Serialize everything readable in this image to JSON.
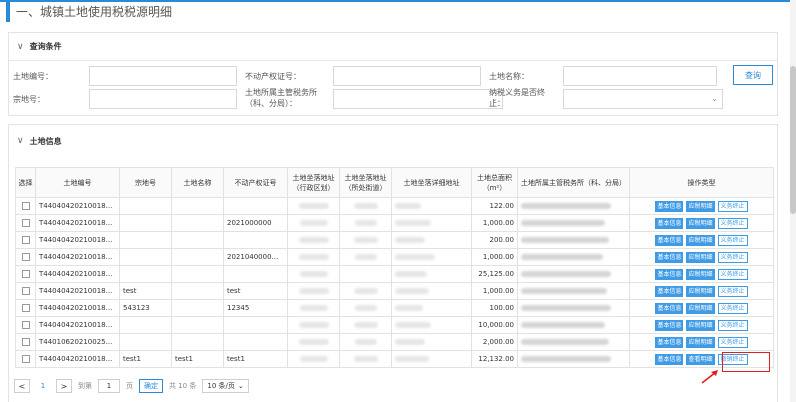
{
  "page": {
    "title": "一、城镇土地使用税税源明细"
  },
  "query": {
    "header": "查询条件",
    "land_no_label": "土地编号：",
    "cert_no_label": "不动产权证号：",
    "land_name_label": "土地名称：",
    "parcel_no_label": "宗地号：",
    "tax_office_label": "土地所属主管税务所（科、分局）：",
    "taxpayer_label": "纳税义务是否终止：",
    "query_button": "查询"
  },
  "land": {
    "header": "土地信息",
    "columns": [
      "选择",
      "土地编号",
      "宗地号",
      "土地名称",
      "不动产权证号",
      "土地坐落地址（行政区划）",
      "土地坐落地址（所处街道）",
      "土地坐落详细地址",
      "土地总面积（m²）",
      "土地所属主管税务所（科、分局）",
      "操作类型"
    ],
    "rows": [
      {
        "land_no": "T44040420210018...",
        "parcel": "",
        "name": "",
        "cert": "",
        "area": "122.00",
        "op1": "基本信息",
        "op2": "应税明细",
        "op3": "义务终止"
      },
      {
        "land_no": "T44040420210018...",
        "parcel": "",
        "name": "",
        "cert": "2021000000",
        "area": "1,000.00",
        "op1": "基本信息",
        "op2": "应税明细",
        "op3": "义务终止"
      },
      {
        "land_no": "T44040420210018...",
        "parcel": "",
        "name": "",
        "cert": "",
        "area": "200.00",
        "op1": "基本信息",
        "op2": "应税明细",
        "op3": "义务终止"
      },
      {
        "land_no": "T44040420210018...",
        "parcel": "",
        "name": "",
        "cert": "2021040000...",
        "area": "1,000.00",
        "op1": "基本信息",
        "op2": "应税明细",
        "op3": "义务终止"
      },
      {
        "land_no": "T44040420210018...",
        "parcel": "",
        "name": "",
        "cert": "",
        "area": "25,125.00",
        "op1": "基本信息",
        "op2": "应税明细",
        "op3": "义务终止"
      },
      {
        "land_no": "T44040420210018...",
        "parcel": "test",
        "name": "",
        "cert": "test",
        "area": "1,000.00",
        "op1": "基本信息",
        "op2": "应税明细",
        "op3": "义务终止"
      },
      {
        "land_no": "T44040420210018...",
        "parcel": "543123",
        "name": "",
        "cert": "12345",
        "area": "100.00",
        "op1": "基本信息",
        "op2": "应税明细",
        "op3": "义务终止"
      },
      {
        "land_no": "T44040420210018...",
        "parcel": "",
        "name": "",
        "cert": "",
        "area": "10,000.00",
        "op1": "基本信息",
        "op2": "应税明细",
        "op3": "义务终止"
      },
      {
        "land_no": "T44010620210025...",
        "parcel": "",
        "name": "",
        "cert": "",
        "area": "2,000.00",
        "op1": "基本信息",
        "op2": "应税明细",
        "op3": "义务终止"
      },
      {
        "land_no": "T44040420210018...",
        "parcel": "test1",
        "name": "test1",
        "cert": "test1",
        "area": "12,132.00",
        "op1": "基本信息",
        "op2": "查看明细",
        "op3": "撤销终止"
      }
    ]
  },
  "pager": {
    "prev": "<",
    "current": "1",
    "next": ">",
    "goto_label": "到第",
    "goto_value": "1",
    "page_unit": "页",
    "confirm": "确定",
    "total": "共 10 条",
    "page_size": "10 条/页"
  },
  "colors": {
    "accent": "#2b8ad8",
    "op_blue": "#3f9be6",
    "highlight": "#e02020"
  }
}
